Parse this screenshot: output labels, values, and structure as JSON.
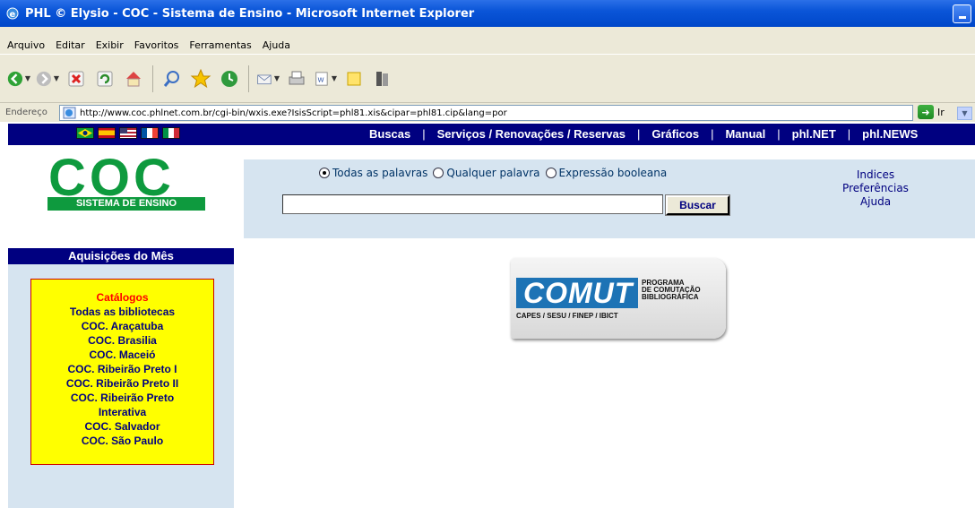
{
  "window": {
    "title": "PHL © Elysio - COC - Sistema de Ensino - Microsoft Internet Explorer"
  },
  "menu": {
    "items": [
      "Arquivo",
      "Editar",
      "Exibir",
      "Favoritos",
      "Ferramentas",
      "Ajuda"
    ]
  },
  "address": {
    "label": "Endereço",
    "url": "http://www.coc.phlnet.com.br/cgi-bin/wxis.exe?IsisScript=phl81.xis&cipar=phl81.cip&lang=por",
    "go_label": "Ir"
  },
  "nav": {
    "links": [
      "Buscas",
      "Serviços / Renovações / Reservas",
      "Gráficos",
      "Manual",
      "phl.NET",
      "phl.NEWS"
    ],
    "flags": [
      "brazil-flag",
      "spain-flag",
      "usa-flag",
      "france-flag",
      "italy-flag"
    ]
  },
  "logo": {
    "text": "COC",
    "subtitle": "SISTEMA DE ENSINO"
  },
  "sidebar": {
    "header": "Aquisições do Mês",
    "catalog_title": "Catálogos",
    "catalogs": [
      "Todas as bibliotecas",
      "COC. Araçatuba",
      "COC. Brasilia",
      "COC. Maceió",
      "COC. Ribeirão Preto I",
      "COC. Ribeirão Preto II",
      "COC. Ribeirão Preto Interativa",
      "COC. Salvador",
      "COC. São Paulo"
    ]
  },
  "search": {
    "options": [
      "Todas as palavras",
      "Qualquer palavra",
      "Expressão booleana"
    ],
    "selected": "Todas as palavras",
    "query": "",
    "button_label": "Buscar",
    "side_links": [
      "Indices",
      "Preferências",
      "Ajuda"
    ]
  },
  "banner": {
    "word": "COMUT",
    "program_line1": "PROGRAMA",
    "program_line2": "DE COMUTAÇÃO",
    "program_line3": "BIBLIOGRÁFICA",
    "subtitle": "CAPES / SESU / FINEP / IBICT"
  },
  "colors": {
    "nav_bg": "#000080",
    "panel_bg": "#d6e4f0",
    "logo_green": "#0e9a3e",
    "catalog_bg": "#ffff00"
  }
}
